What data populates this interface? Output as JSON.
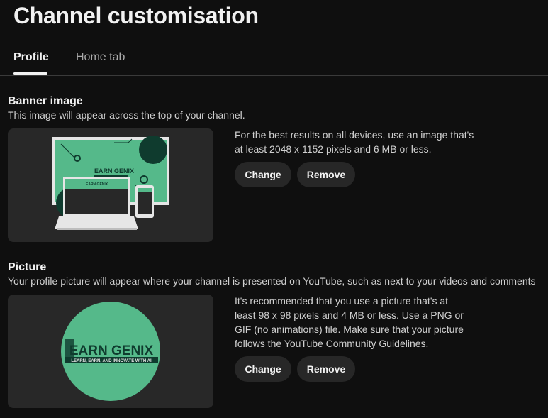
{
  "page": {
    "title": "Channel customisation"
  },
  "tabs": [
    {
      "label": "Profile",
      "active": true
    },
    {
      "label": "Home tab",
      "active": false
    }
  ],
  "banner": {
    "title": "Banner image",
    "description": "This image will appear across the top of your channel.",
    "info_line1": "For the best results on all devices, use an image that's",
    "info_line2": "at least 2048 x 1152 pixels and 6 MB or less.",
    "change_label": "Change",
    "remove_label": "Remove",
    "brand_text": "EARN GENIX"
  },
  "picture": {
    "title": "Picture",
    "description": "Your profile picture will appear where your channel is presented on YouTube, such as next to your videos and comments",
    "info_line1": "It's recommended that you use a picture that's at",
    "info_line2": "least 98 x 98 pixels and 4 MB or less. Use a PNG or",
    "info_line3": "GIF (no animations) file. Make sure that your picture",
    "info_line4": "follows the YouTube Community Guidelines.",
    "change_label": "Change",
    "remove_label": "Remove",
    "logo_title": "EARN GENIX",
    "logo_tagline": "LEARN, EARN, AND INNOVATE WITH AI"
  },
  "colors": {
    "background": "#0f0f0f",
    "brand_green": "#55b98a",
    "dark_green": "#0f3b2e",
    "button_bg": "#272727"
  }
}
